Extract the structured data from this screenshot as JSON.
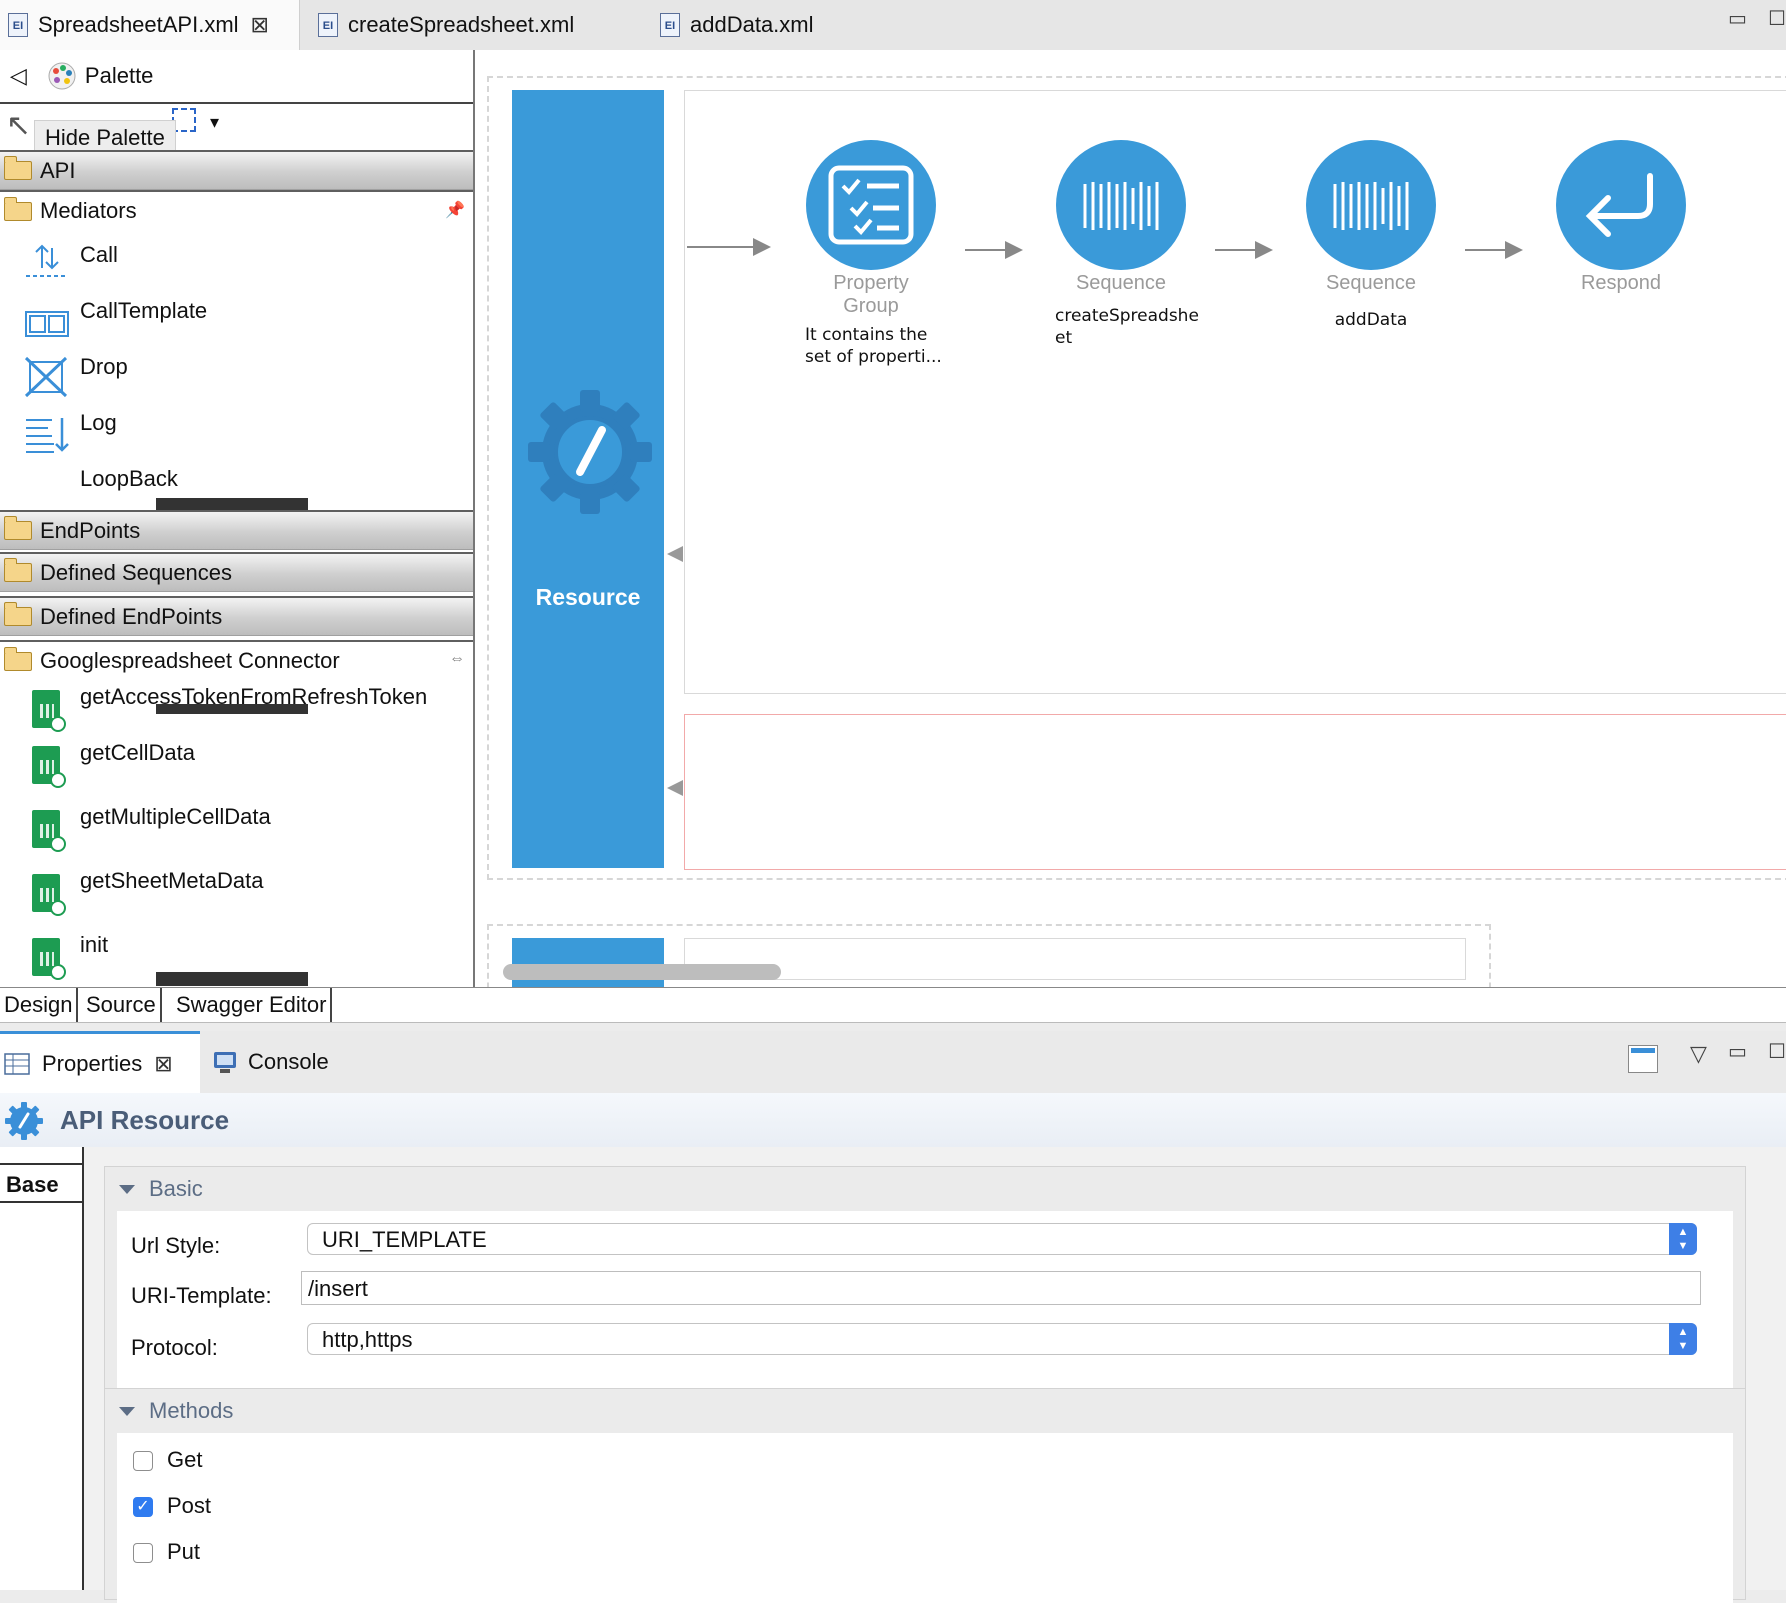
{
  "editor_tabs": [
    {
      "label": "SpreadsheetAPI.xml",
      "icon": "EI",
      "active": true
    },
    {
      "label": "createSpreadsheet.xml",
      "icon": "EI",
      "active": false
    },
    {
      "label": "addData.xml",
      "icon": "EI",
      "active": false
    }
  ],
  "palette": {
    "title": "Palette",
    "tooltip": "Hide Palette",
    "categories": {
      "api": "API",
      "mediators": "Mediators",
      "endpoints": "EndPoints",
      "defined_sequences": "Defined Sequences",
      "defined_endpoints": "Defined EndPoints",
      "connector": "Googlespreadsheet Connector"
    },
    "mediators": [
      "Call",
      "CallTemplate",
      "Drop",
      "Log",
      "LoopBack"
    ],
    "connector_ops": [
      "getAccessTokenFromRefreshToken",
      "getCellData",
      "getMultipleCellData",
      "getSheetMetaData",
      "init"
    ]
  },
  "canvas": {
    "resource_label": "Resource",
    "nodes": [
      {
        "type": "Property Group",
        "desc": [
          "It contains the",
          "set of properti..."
        ],
        "icon": "checklist-icon"
      },
      {
        "type": "Sequence",
        "desc": [
          "createSpreadshe",
          "et"
        ],
        "icon": "sequence-icon"
      },
      {
        "type": "Sequence",
        "desc": [
          "addData"
        ],
        "icon": "sequence-icon"
      },
      {
        "type": "Respond",
        "desc": [],
        "icon": "respond-icon"
      }
    ]
  },
  "editor_bottom_tabs": [
    "Design",
    "Source",
    "Swagger Editor"
  ],
  "view_tabs": {
    "properties": "Properties",
    "console": "Console"
  },
  "properties": {
    "header": "API Resource",
    "side_tab": "Base",
    "basic": {
      "title": "Basic",
      "url_style_label": "Url Style:",
      "url_style_value": "URI_TEMPLATE",
      "uri_template_label": "URI-Template:",
      "uri_template_value": "/insert",
      "protocol_label": "Protocol:",
      "protocol_value": "http,https"
    },
    "methods": {
      "title": "Methods",
      "items": [
        {
          "label": "Get",
          "checked": false
        },
        {
          "label": "Post",
          "checked": true
        },
        {
          "label": "Put",
          "checked": false
        }
      ]
    }
  },
  "colors": {
    "accent": "#3a9ad9",
    "checkbox": "#2f7bf0",
    "section_title": "#5c6d85"
  }
}
